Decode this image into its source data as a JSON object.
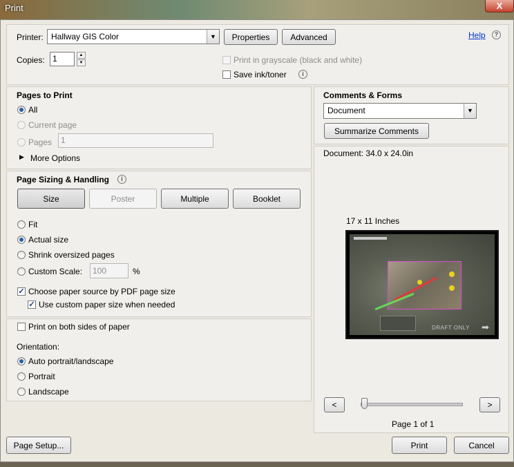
{
  "window": {
    "title": "Print",
    "close_label": "X"
  },
  "printer": {
    "label": "Printer:",
    "selected": "Hallway GIS Color",
    "properties_label": "Properties",
    "advanced_label": "Advanced",
    "help_label": "Help"
  },
  "copies": {
    "label": "Copies:",
    "value": "1"
  },
  "options": {
    "grayscale_label": "Print in grayscale (black and white)",
    "save_ink_label": "Save ink/toner"
  },
  "pages_to_print": {
    "heading": "Pages to Print",
    "all_label": "All",
    "current_label": "Current page",
    "pages_label": "Pages",
    "pages_value": "1",
    "more_options_label": "More Options"
  },
  "page_sizing": {
    "heading": "Page Sizing & Handling",
    "size_label": "Size",
    "poster_label": "Poster",
    "multiple_label": "Multiple",
    "booklet_label": "Booklet",
    "fit_label": "Fit",
    "actual_label": "Actual size",
    "shrink_label": "Shrink oversized pages",
    "custom_label": "Custom Scale:",
    "custom_value": "100",
    "percent_label": "%",
    "paper_source_label": "Choose paper source by PDF page size",
    "custom_paper_label": "Use custom paper size when needed"
  },
  "duplex": {
    "label": "Print on both sides of paper"
  },
  "orientation": {
    "heading": "Orientation:",
    "auto_label": "Auto portrait/landscape",
    "portrait_label": "Portrait",
    "landscape_label": "Landscape"
  },
  "comments_forms": {
    "heading": "Comments & Forms",
    "selected": "Document",
    "summarize_label": "Summarize Comments"
  },
  "preview": {
    "doc_size": "Document: 34.0 x 24.0in",
    "paper_size": "17 x 11 Inches",
    "watermark": "DRAFT ONLY",
    "prev_label": "<",
    "next_label": ">",
    "page_indicator": "Page 1 of 1"
  },
  "footer": {
    "page_setup_label": "Page Setup...",
    "print_label": "Print",
    "cancel_label": "Cancel"
  },
  "colors": {
    "accent": "#2a5fa8",
    "link": "#0033cc",
    "close": "#c7442e"
  }
}
